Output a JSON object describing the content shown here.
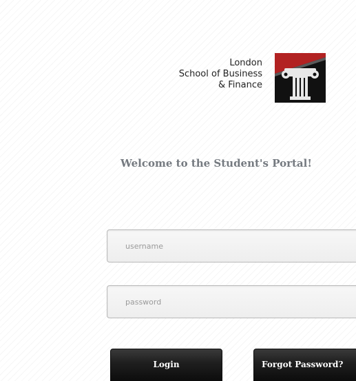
{
  "logo": {
    "line1": "London",
    "line2": "School of Business",
    "line3": "& Finance",
    "emblem_icon": "ionic-column-icon",
    "accent_color": "#b22222"
  },
  "welcome": {
    "heading": "Welcome to the Student's Portal!"
  },
  "login_form": {
    "username_placeholder": "username",
    "password_placeholder": "password",
    "login_label": "Login",
    "forgot_label": "Forgot Password?"
  }
}
